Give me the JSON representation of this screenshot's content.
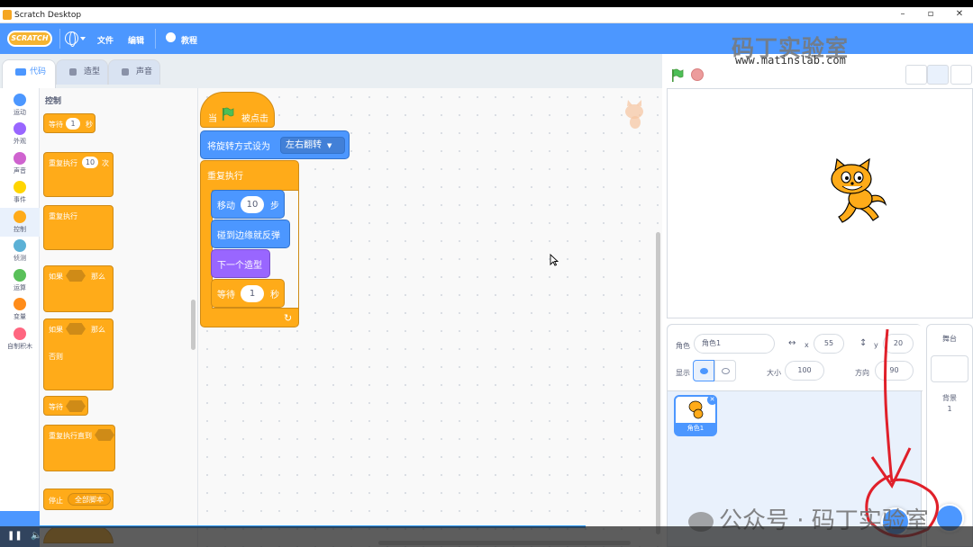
{
  "window": {
    "title": "Scratch Desktop"
  },
  "menubar": {
    "logo": "SCRATCH",
    "file": "文件",
    "edit": "编辑",
    "tutorials": "教程"
  },
  "watermark": {
    "brand": "码丁实验室",
    "url": "www.matinslab.com",
    "overlay": "公众号 · 码丁实验室"
  },
  "tabs": [
    {
      "label": "代码"
    },
    {
      "label": "造型"
    },
    {
      "label": "声音"
    }
  ],
  "categories": [
    {
      "label": "运动",
      "color": "#4c97ff"
    },
    {
      "label": "外观",
      "color": "#9966ff"
    },
    {
      "label": "声音",
      "color": "#cf63cf"
    },
    {
      "label": "事件",
      "color": "#ffd500"
    },
    {
      "label": "控制",
      "color": "#ffab19"
    },
    {
      "label": "侦测",
      "color": "#5cb1d6"
    },
    {
      "label": "运算",
      "color": "#59c059"
    },
    {
      "label": "变量",
      "color": "#ff8c1a"
    },
    {
      "label": "自制积木",
      "color": "#ff6680"
    }
  ],
  "palette": {
    "title": "控制",
    "wait": {
      "label": "等待",
      "value": "1",
      "unit": "秒"
    },
    "repeat": {
      "label": "重复执行",
      "value": "10",
      "unit": "次"
    },
    "forever": {
      "label": "重复执行"
    },
    "if_then": {
      "if": "如果",
      "then": "那么"
    },
    "if_else": {
      "if": "如果",
      "then": "那么",
      "else": "否则"
    },
    "wait_until": {
      "label": "等待"
    },
    "repeat_until": {
      "label": "重复执行直到"
    },
    "stop": {
      "label": "停止",
      "option": "全部脚本"
    }
  },
  "script": {
    "hat": {
      "pre": "当",
      "post": "被点击"
    },
    "rotation": {
      "label": "将旋转方式设为",
      "option": "左右翻转"
    },
    "forever": "重复执行",
    "move": {
      "label": "移动",
      "value": "10",
      "unit": "步"
    },
    "bounce": "碰到边缘就反弹",
    "next_costume": "下一个造型",
    "wait": {
      "label": "等待",
      "value": "1",
      "unit": "秒"
    }
  },
  "zoom": {
    "in": "+",
    "out": "−",
    "reset": "="
  },
  "sprite_info": {
    "sprite_label": "角色",
    "sprite_name": "角色1",
    "x_label": "x",
    "x": "55",
    "y_label": "y",
    "y": "20",
    "show_label": "显示",
    "size_label": "大小",
    "size": "100",
    "direction_label": "方向",
    "direction": "90"
  },
  "sprite_list": [
    {
      "name": "角色1"
    }
  ],
  "stage_pane": {
    "title": "舞台",
    "backdrops_label": "背景",
    "backdrops_count": "1"
  },
  "colors": {
    "scratch_blue": "#4c97ff",
    "control": "#ffab19",
    "motion": "#4c97ff",
    "looks": "#9966ff",
    "annotation": "#e0202a"
  }
}
